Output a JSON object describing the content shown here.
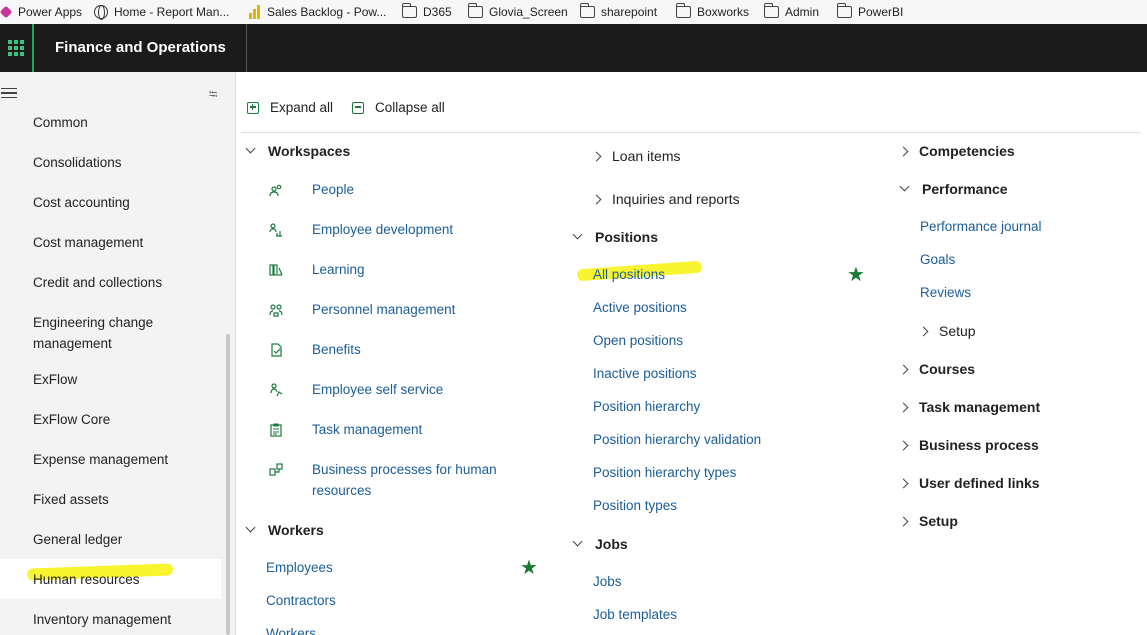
{
  "bookmarks": [
    "Power Apps",
    "Home - Report Man...",
    "Sales Backlog - Pow...",
    "D365",
    "Glovia_Screen",
    "sharepoint",
    "Boxworks",
    "Admin",
    "PowerBI"
  ],
  "app": {
    "title": "Finance and Operations"
  },
  "sidenav": {
    "items": [
      "Common",
      "Consolidations",
      "Cost accounting",
      "Cost management",
      "Credit and collections",
      "Engineering change management",
      "ExFlow",
      "ExFlow Core",
      "Expense management",
      "Fixed assets",
      "General ledger",
      "Human resources",
      "Inventory management"
    ],
    "selected": "Human resources"
  },
  "toolbar": {
    "expand_all": "Expand all",
    "collapse_all": "Collapse all"
  },
  "workspaces": {
    "header": "Workspaces",
    "items": [
      {
        "label": "People",
        "icon": "people-icon"
      },
      {
        "label": "Employee development",
        "icon": "employee-development-icon"
      },
      {
        "label": "Learning",
        "icon": "learning-icon"
      },
      {
        "label": "Personnel management",
        "icon": "personnel-icon"
      },
      {
        "label": "Benefits",
        "icon": "benefits-icon"
      },
      {
        "label": "Employee self service",
        "icon": "self-service-icon"
      },
      {
        "label": "Task management",
        "icon": "task-icon"
      },
      {
        "label": "Business processes for human resources",
        "icon": "business-process-icon"
      }
    ]
  },
  "workers": {
    "header": "Workers",
    "items": [
      "Employees",
      "Contractors",
      "Workers"
    ]
  },
  "col2": {
    "collapsed_top": [
      "Loan items",
      "Inquiries and reports"
    ],
    "positions_header": "Positions",
    "positions": [
      "All positions",
      "Active positions",
      "Open positions",
      "Inactive positions",
      "Position hierarchy",
      "Position hierarchy validation",
      "Position hierarchy types",
      "Position types"
    ],
    "jobs_header": "Jobs",
    "jobs": [
      "Jobs",
      "Job templates"
    ]
  },
  "col3": {
    "competencies": "Competencies",
    "performance_header": "Performance",
    "performance": [
      "Performance journal",
      "Goals",
      "Reviews"
    ],
    "performance_setup": "Setup",
    "collapsed": [
      "Courses",
      "Task management",
      "Business process",
      "User defined links",
      "Setup"
    ]
  },
  "colors": {
    "accent": "#1b5d98",
    "appbar": "#1b1b1b",
    "highlight": "#f7f20a",
    "star": "#1a7a33"
  }
}
